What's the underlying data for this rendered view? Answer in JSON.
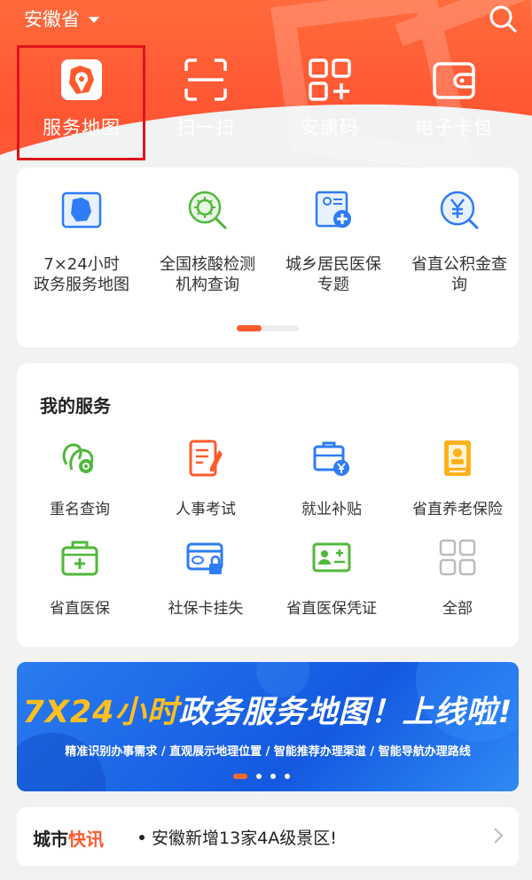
{
  "header": {
    "region": "安徽省"
  },
  "quick_actions": [
    {
      "label": "服务地图",
      "icon": "map-pin-icon"
    },
    {
      "label": "扫一扫",
      "icon": "scan-icon"
    },
    {
      "label": "安康码",
      "icon": "qr-code-icon"
    },
    {
      "label": "电子卡包",
      "icon": "wallet-icon"
    }
  ],
  "featured": [
    {
      "line1": "7×24小时",
      "line2": "政务服务地图",
      "icon": "province-map-icon"
    },
    {
      "line1": "全国核酸检测",
      "line2": "机构查询",
      "icon": "virus-search-icon"
    },
    {
      "line1": "城乡居民医保",
      "line2": "专题",
      "icon": "insurance-card-icon"
    },
    {
      "line1": "省直公积金查",
      "line2": "询",
      "icon": "yuan-search-icon"
    }
  ],
  "my_services": {
    "title": "我的服务",
    "items": [
      {
        "label": "重名查询",
        "icon": "people-search-icon"
      },
      {
        "label": "人事考试",
        "icon": "exam-icon"
      },
      {
        "label": "就业补贴",
        "icon": "subsidy-icon"
      },
      {
        "label": "省直养老保险",
        "icon": "pension-icon"
      },
      {
        "label": "省直医保",
        "icon": "medical-kit-icon"
      },
      {
        "label": "社保卡挂失",
        "icon": "card-lock-icon"
      },
      {
        "label": "省直医保凭证",
        "icon": "medical-id-icon"
      },
      {
        "label": "全部",
        "icon": "grid-icon"
      }
    ]
  },
  "banner": {
    "title_a": "7X24小时",
    "title_b": "政务服务地图！",
    "title_c": "上线啦!",
    "subtitle": "精准识别办事需求 / 直观展示地理位置 / 智能推荐办理渠道 / 智能导航办理路线"
  },
  "news": {
    "label_a": "城市",
    "label_b": "快讯",
    "headline": "安徽新增13家4A级景区!"
  },
  "colors": {
    "brand": "#ff5a2c",
    "highlight_box": "#e0131c",
    "banner_blue": "#1459e0"
  }
}
